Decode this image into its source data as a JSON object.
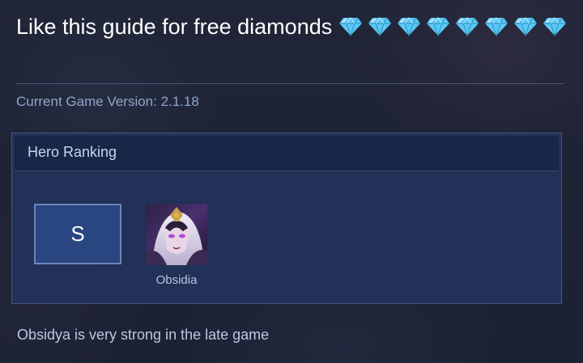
{
  "header": {
    "promo_text": "Like this guide for free diamonds",
    "diamond_count": 8,
    "version_text": "Current Game Version: 2.1.18"
  },
  "ranking": {
    "title": "Hero Ranking",
    "tiers": [
      {
        "label": "S",
        "heroes": [
          {
            "name": "Obsidia",
            "portrait_icon": "obsidia-portrait"
          }
        ]
      }
    ]
  },
  "note": "Obsidya is very strong in the late game",
  "colors": {
    "panel": "#22335c",
    "panel_header": "#182648",
    "tier_badge": "#2a4680",
    "version_text": "#8fa6c8",
    "diamond": "#5ac8f5"
  }
}
